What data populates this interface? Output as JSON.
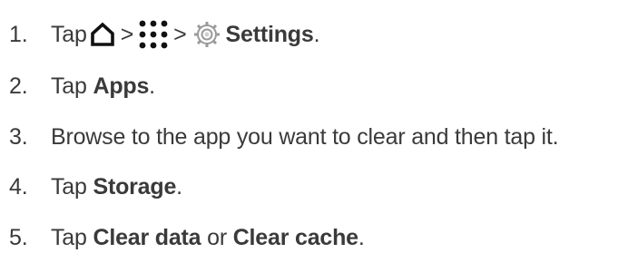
{
  "steps": [
    {
      "number": "1.",
      "tap": "Tap",
      "sep1": ">",
      "sep2": ">",
      "target": "Settings",
      "end": ".",
      "icons": [
        "home-icon",
        "apps-icon",
        "gear-icon"
      ]
    },
    {
      "number": "2.",
      "tap": "Tap",
      "target": "Apps",
      "end": "."
    },
    {
      "number": "3.",
      "text": "Browse to the app you want to clear and then tap it."
    },
    {
      "number": "4.",
      "tap": "Tap",
      "target": "Storage",
      "end": "."
    },
    {
      "number": "5.",
      "tap": "Tap",
      "target": "Clear data",
      "middle": "or",
      "target2": "Clear cache",
      "end": "."
    }
  ]
}
